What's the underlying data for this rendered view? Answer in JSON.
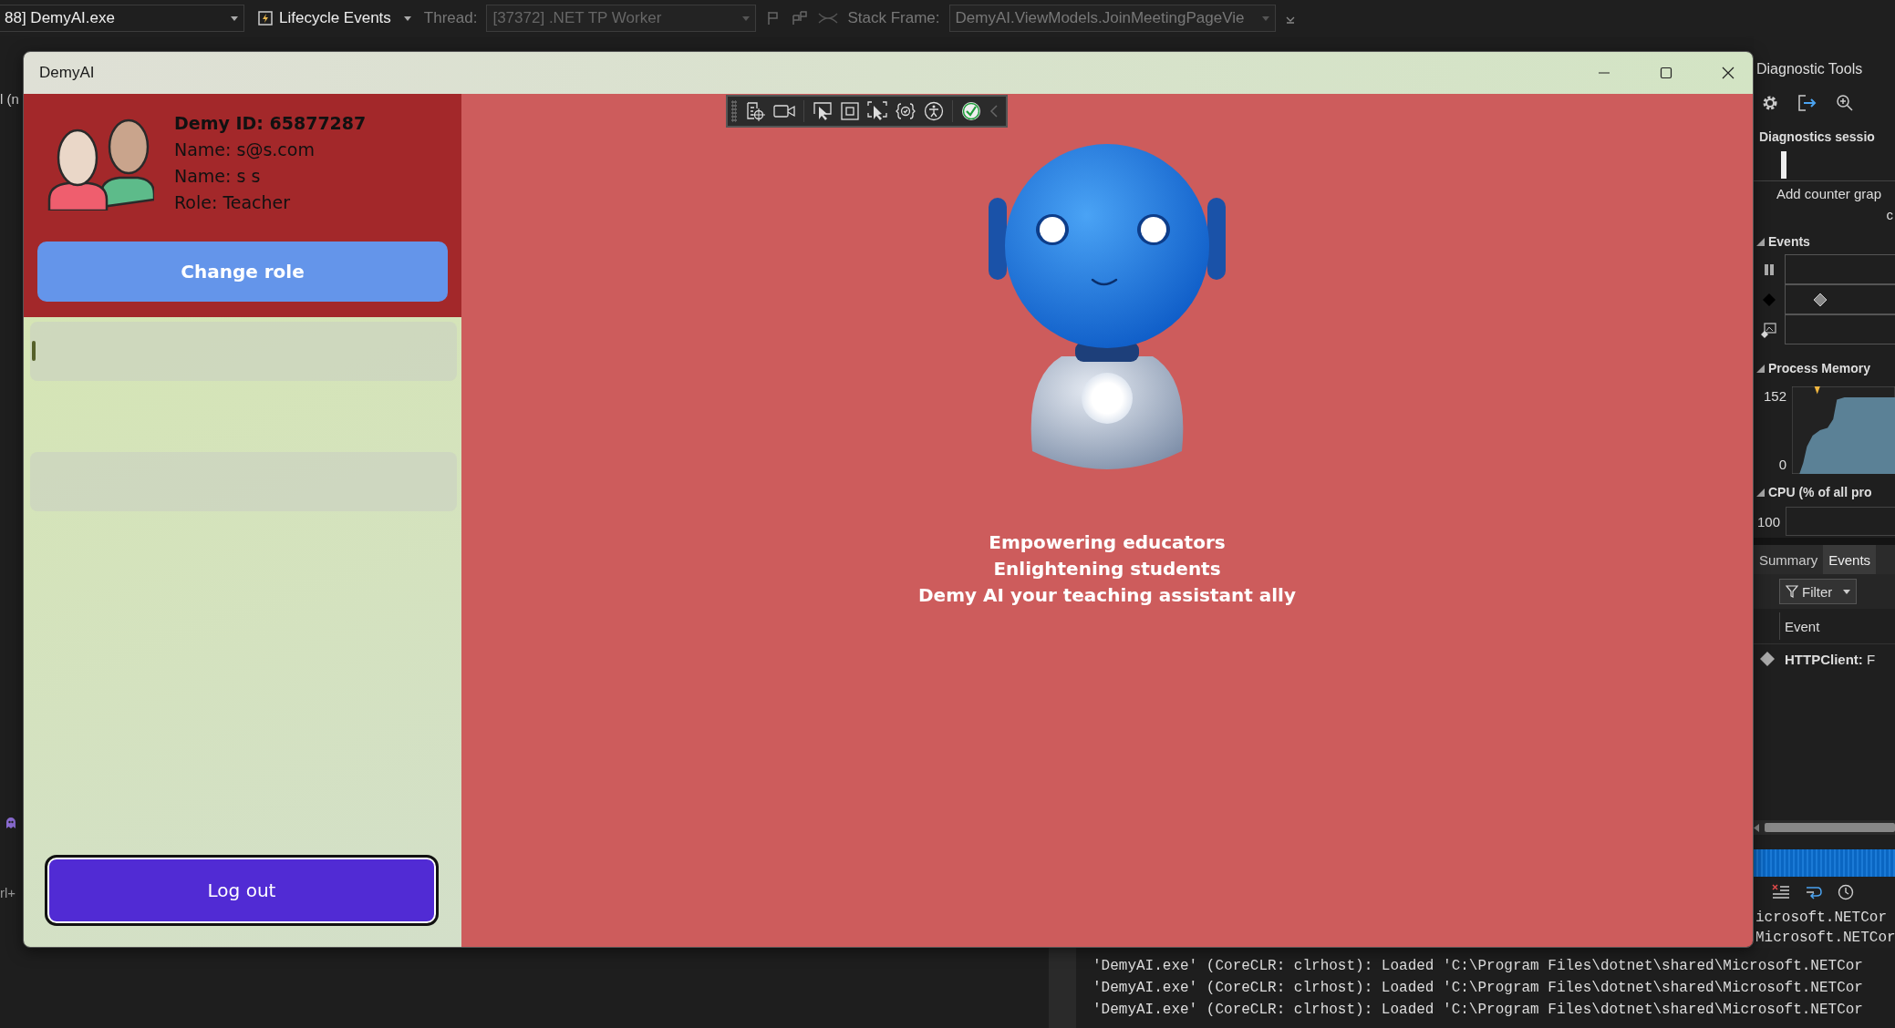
{
  "debugger_toolbar": {
    "process": "88] DemyAI.exe",
    "lifecycle": "Lifecycle Events",
    "thread_label": "Thread:",
    "thread": "[37372] .NET TP Worker",
    "stack_frame_label": "Stack Frame:",
    "stack_frame": "DemyAI.ViewModels.JoinMeetingPageVie"
  },
  "editor_fragments": {
    "top": "l (n",
    "bottom": "rl+"
  },
  "app_window": {
    "title": "DemyAI",
    "profile": {
      "lines": [
        {
          "kind": "heading",
          "text": "Demy ID: 65877287"
        },
        {
          "kind": "plain",
          "text": "Name: s@s.com"
        },
        {
          "kind": "plain",
          "text": "Name: s s"
        },
        {
          "kind": "plain",
          "text": "Role: Teacher"
        }
      ]
    },
    "change_role_button": "Change role",
    "list_items": [
      {
        "focused": true
      },
      {
        "focused": false
      }
    ],
    "logout_button": "Log out",
    "tagline": [
      "Empowering educators",
      "Enlightening students",
      "Demy AI your teaching assistant ally"
    ]
  },
  "diagnostic_tools": {
    "title": "Diagnostic Tools",
    "session_heading": "Diagnostics sessio",
    "add_counter": [
      "Add counter grap",
      "c"
    ],
    "events_heading": "Events",
    "memory_heading": "Process Memory",
    "memory_ticks": [
      "152",
      "0"
    ],
    "cpu_heading": "CPU (% of all pro",
    "cpu_tick": "100",
    "tabs": [
      {
        "label": "Summary",
        "selected": false
      },
      {
        "label": "Events",
        "selected": true
      }
    ],
    "filter_button": "Filter",
    "event_column": "Event",
    "event_rows": [
      "**HTTPClient:** F"
    ]
  },
  "output": {
    "fragments": [
      "icrosoft.NETCor",
      "Microsoft.NETCor"
    ],
    "lines": [
      "'DemyAI.exe' (CoreCLR: clrhost): Loaded 'C:\\Program Files\\dotnet\\shared\\Microsoft.NETCor",
      "'DemyAI.exe' (CoreCLR: clrhost): Loaded 'C:\\Program Files\\dotnet\\shared\\Microsoft.NETCor",
      "'DemyAI.exe' (CoreCLR: clrhost): Loaded 'C:\\Program Files\\dotnet\\shared\\Microsoft.NETCor"
    ]
  }
}
